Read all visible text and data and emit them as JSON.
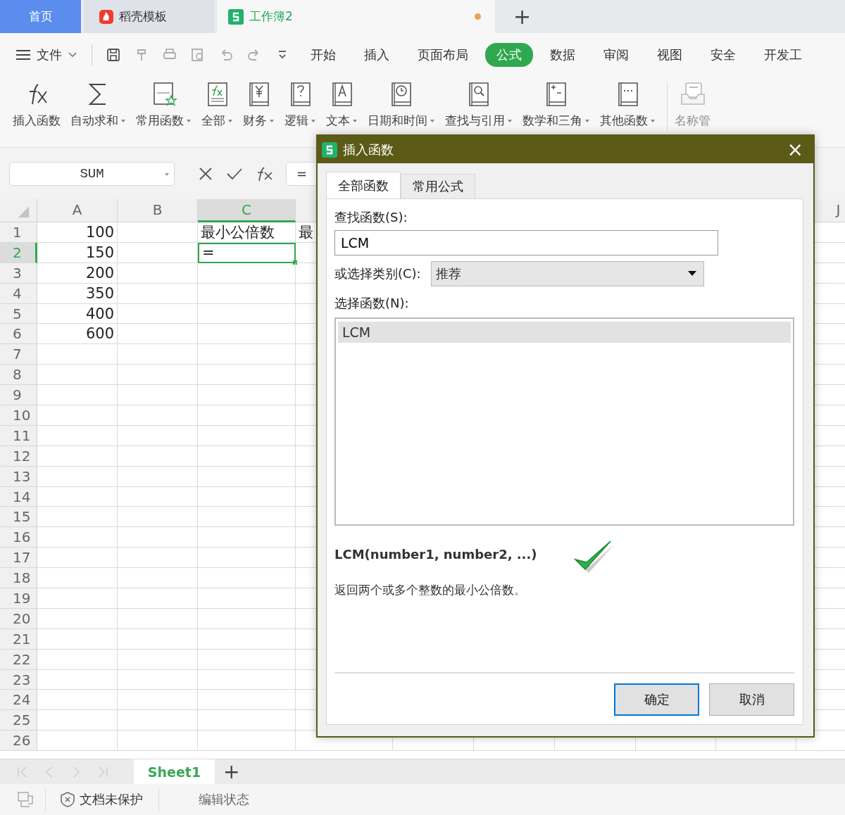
{
  "tabs": [
    {
      "kind": "home",
      "label": "首页",
      "selected": false
    },
    {
      "kind": "template",
      "label": "稻壳模板",
      "selected": false
    },
    {
      "kind": "sheet",
      "label": "工作簿2",
      "selected": true,
      "modified": true
    }
  ],
  "new_tab": "+",
  "file_menu": "文件",
  "menu": [
    {
      "label": "开始",
      "selected": false
    },
    {
      "label": "插入",
      "selected": false
    },
    {
      "label": "页面布局",
      "selected": false
    },
    {
      "label": "公式",
      "selected": true
    },
    {
      "label": "数据",
      "selected": false
    },
    {
      "label": "审阅",
      "selected": false
    },
    {
      "label": "视图",
      "selected": false
    },
    {
      "label": "安全",
      "selected": false
    },
    {
      "label": "开发工",
      "selected": false
    }
  ],
  "ribbon": [
    {
      "kind": "fx",
      "label": "插入函数",
      "dropdown": false,
      "disabled": false
    },
    {
      "kind": "sum",
      "label": "自动求和",
      "dropdown": true,
      "disabled": false
    },
    {
      "kind": "star",
      "label": "常用函数",
      "dropdown": true,
      "disabled": false
    },
    {
      "kind": "fxbook",
      "label": "全部",
      "dropdown": true,
      "disabled": false
    },
    {
      "kind": "yen",
      "label": "财务",
      "dropdown": true,
      "disabled": false
    },
    {
      "kind": "question",
      "label": "逻辑",
      "dropdown": true,
      "disabled": false
    },
    {
      "kind": "letter",
      "label": "文本",
      "dropdown": true,
      "disabled": false
    },
    {
      "kind": "clock",
      "label": "日期和时间",
      "dropdown": true,
      "disabled": false
    },
    {
      "kind": "lens",
      "label": "查找与引用",
      "dropdown": true,
      "disabled": false
    },
    {
      "kind": "math",
      "label": "数学和三角",
      "dropdown": true,
      "disabled": false
    },
    {
      "kind": "dots",
      "label": "其他函数",
      "dropdown": true,
      "disabled": false
    },
    {
      "kind": "tray",
      "label": "名称管",
      "dropdown": false,
      "disabled": true
    }
  ],
  "formula_bar": {
    "name_box": "SUM",
    "value": "="
  },
  "grid": {
    "columns": [
      {
        "label": "A",
        "selected": false
      },
      {
        "label": "B",
        "selected": false
      },
      {
        "label": "C",
        "selected": true
      },
      {
        "selected": false
      },
      {
        "label": "J",
        "selected": false
      }
    ],
    "rows": [
      {
        "number": "1",
        "selected": false,
        "cells": {
          "A": {
            "text": "100"
          },
          "C": {
            "text": "最小公倍数"
          },
          "column_4": {
            "text": "最"
          }
        }
      },
      {
        "number": "2",
        "selected": true,
        "cells": {
          "A": {
            "text": "150"
          },
          "C": {
            "text": "=",
            "active": true
          }
        }
      },
      {
        "number": "3",
        "selected": false,
        "cells": {
          "A": {
            "text": "200"
          }
        }
      },
      {
        "number": "4",
        "selected": false,
        "cells": {
          "A": {
            "text": "350"
          }
        }
      },
      {
        "number": "5",
        "selected": false,
        "cells": {
          "A": {
            "text": "400"
          }
        }
      },
      {
        "number": "6",
        "selected": false,
        "cells": {
          "A": {
            "text": "600"
          }
        }
      },
      {
        "number": "7",
        "selected": false,
        "cells": {}
      },
      {
        "number": "8",
        "selected": false,
        "cells": {}
      },
      {
        "number": "9",
        "selected": false,
        "cells": {}
      },
      {
        "number": "10",
        "selected": false,
        "cells": {}
      },
      {
        "number": "11",
        "selected": false,
        "cells": {}
      },
      {
        "number": "12",
        "selected": false,
        "cells": {}
      },
      {
        "number": "13",
        "selected": false,
        "cells": {}
      },
      {
        "number": "14",
        "selected": false,
        "cells": {}
      },
      {
        "number": "15",
        "selected": false,
        "cells": {}
      },
      {
        "number": "16",
        "selected": false,
        "cells": {}
      },
      {
        "number": "17",
        "selected": false,
        "cells": {}
      },
      {
        "number": "18",
        "selected": false,
        "cells": {}
      },
      {
        "number": "19",
        "selected": false,
        "cells": {}
      },
      {
        "number": "20",
        "selected": false,
        "cells": {}
      },
      {
        "number": "21",
        "selected": false,
        "cells": {}
      },
      {
        "number": "22",
        "selected": false,
        "cells": {}
      },
      {
        "number": "23",
        "selected": false,
        "cells": {}
      },
      {
        "number": "24",
        "selected": false,
        "cells": {}
      },
      {
        "number": "25",
        "selected": false,
        "cells": {}
      },
      {
        "number": "26",
        "selected": false,
        "cells": {}
      }
    ]
  },
  "sheet_tabs": [
    {
      "label": "Sheet1",
      "selected": true
    }
  ],
  "add_sheet": "+",
  "status_bar": {
    "protection": "文档未保护",
    "mode": "编辑状态"
  },
  "dialog": {
    "title": "插入函数",
    "close": "×",
    "tabs": [
      {
        "label": "全部函数",
        "selected": true
      },
      {
        "label": "常用公式",
        "selected": false
      }
    ],
    "search_label": "查找函数(S):",
    "search_value": "LCM",
    "category_label": "或选择类别(C):",
    "category": "推荐",
    "list_label": "选择函数(N):",
    "functions": [
      {
        "name": "LCM",
        "selected": true
      }
    ],
    "signature": "LCM(number1, number2, ...)",
    "description": "返回两个或多个整数的最小公倍数。",
    "buttons": [
      {
        "label": "确定",
        "default": true
      },
      {
        "label": "取消",
        "default": false
      }
    ]
  }
}
